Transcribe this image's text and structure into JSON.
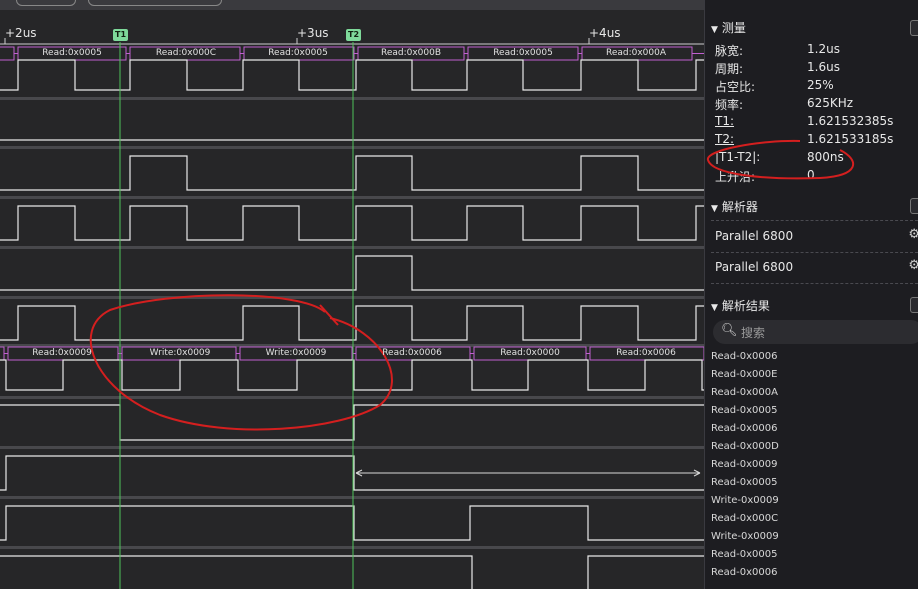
{
  "timeline": {
    "ticks": [
      "+2us",
      "+3us",
      "+4us"
    ],
    "markers": [
      "T1",
      "T2"
    ]
  },
  "bus_top": [
    "Read:0x0005",
    "Read:0x000C",
    "Read:0x0005",
    "Read:0x000B",
    "Read:0x0005",
    "Read:0x000A"
  ],
  "bus_mid": [
    "Read:0x0009",
    "Write:0x0009",
    "Write:0x0009",
    "Read:0x0006",
    "Read:0x0000",
    "Read:0x0006"
  ],
  "panel": {
    "measure": {
      "title": "测量",
      "rows": [
        {
          "key": "脉宽:",
          "value": "1.2us"
        },
        {
          "key": "周期:",
          "value": "1.6us"
        },
        {
          "key": "占空比:",
          "value": "25%"
        },
        {
          "key": "频率:",
          "value": "625KHz"
        },
        {
          "key": "T1:",
          "value": "1.621532385s"
        },
        {
          "key": "T2:",
          "value": "1.621533185s"
        },
        {
          "key": "|T1-T2|:",
          "value": "800ns"
        },
        {
          "key": "上升沿:",
          "value": "0"
        }
      ]
    },
    "decoders": {
      "title": "解析器",
      "items": [
        "Parallel 6800",
        "Parallel 6800"
      ]
    },
    "results": {
      "title": "解析结果",
      "search_placeholder": "搜索",
      "items": [
        "Read-0x0006",
        "Read-0x000E",
        "Read-0x000A",
        "Read-0x0005",
        "Read-0x0006",
        "Read-0x000D",
        "Read-0x0009",
        "Read-0x0005",
        "Write-0x0009",
        "Read-0x000C",
        "Write-0x0009",
        "Read-0x0005",
        "Read-0x0006"
      ]
    }
  }
}
